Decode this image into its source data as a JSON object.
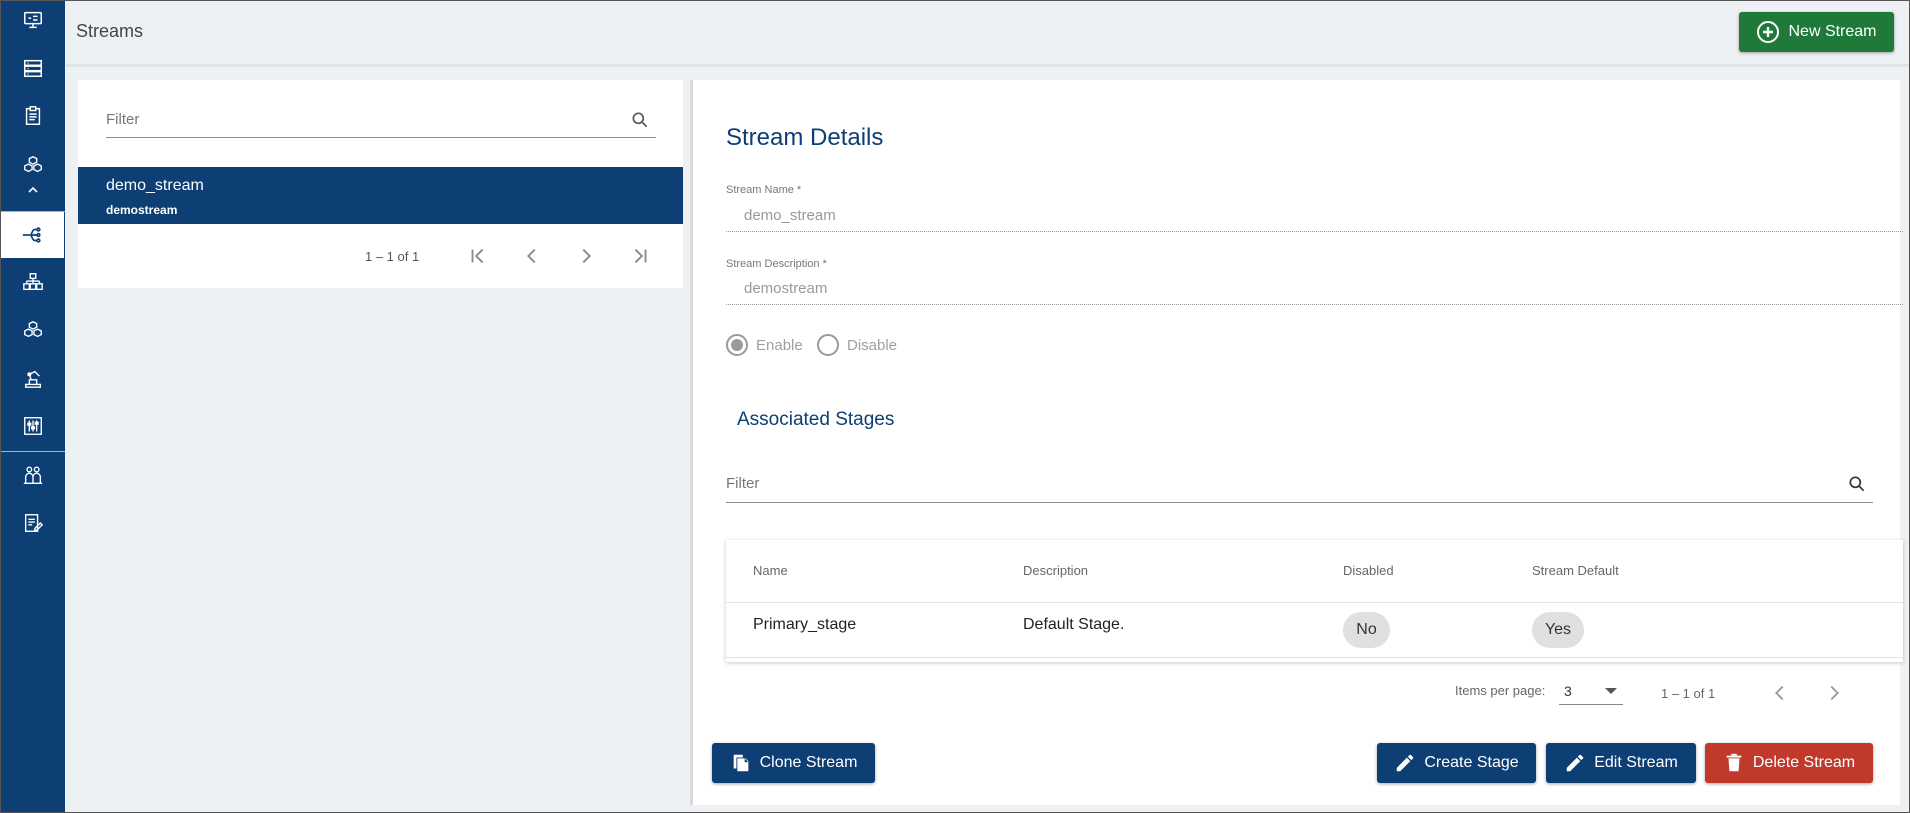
{
  "colors": {
    "sidebar": "#0d3e74",
    "primary": "#0d3e74",
    "success": "#1f7a3a",
    "danger": "#c0392b"
  },
  "sidebar": {
    "items": [
      {
        "icon": "monitor-icon"
      },
      {
        "icon": "server-list-icon"
      },
      {
        "icon": "clipboard-icon"
      },
      {
        "icon": "cubes-icon"
      },
      {
        "icon": "stream-flow-icon",
        "active": true
      },
      {
        "icon": "hierarchy-icon"
      },
      {
        "icon": "cubes-icon"
      },
      {
        "icon": "robot-arm-icon"
      },
      {
        "icon": "sliders-icon"
      },
      {
        "icon": "people-icon"
      },
      {
        "icon": "report-edit-icon"
      }
    ]
  },
  "header": {
    "title": "Streams",
    "new_button": "New Stream"
  },
  "left": {
    "filter_placeholder": "Filter",
    "items": [
      {
        "name": "demo_stream",
        "description": "demostream"
      }
    ],
    "pager": {
      "range": "1 – 1 of 1"
    }
  },
  "details": {
    "title": "Stream Details",
    "name_label": "Stream Name *",
    "name_value": "demo_stream",
    "desc_label": "Stream Description *",
    "desc_value": "demostream",
    "enable_label": "Enable",
    "disable_label": "Disable",
    "selected": "Enable"
  },
  "stages": {
    "title": "Associated Stages",
    "filter_placeholder": "Filter",
    "columns": [
      "Name",
      "Description",
      "Disabled",
      "Stream Default"
    ],
    "rows": [
      {
        "name": "Primary_stage",
        "description": "Default Stage.",
        "disabled": "No",
        "stream_default": "Yes"
      }
    ],
    "items_per_page_label": "Items per page:",
    "items_per_page": "3",
    "range": "1 – 1 of 1"
  },
  "actions": {
    "clone": "Clone Stream",
    "create_stage": "Create Stage",
    "edit": "Edit Stream",
    "delete": "Delete Stream"
  }
}
